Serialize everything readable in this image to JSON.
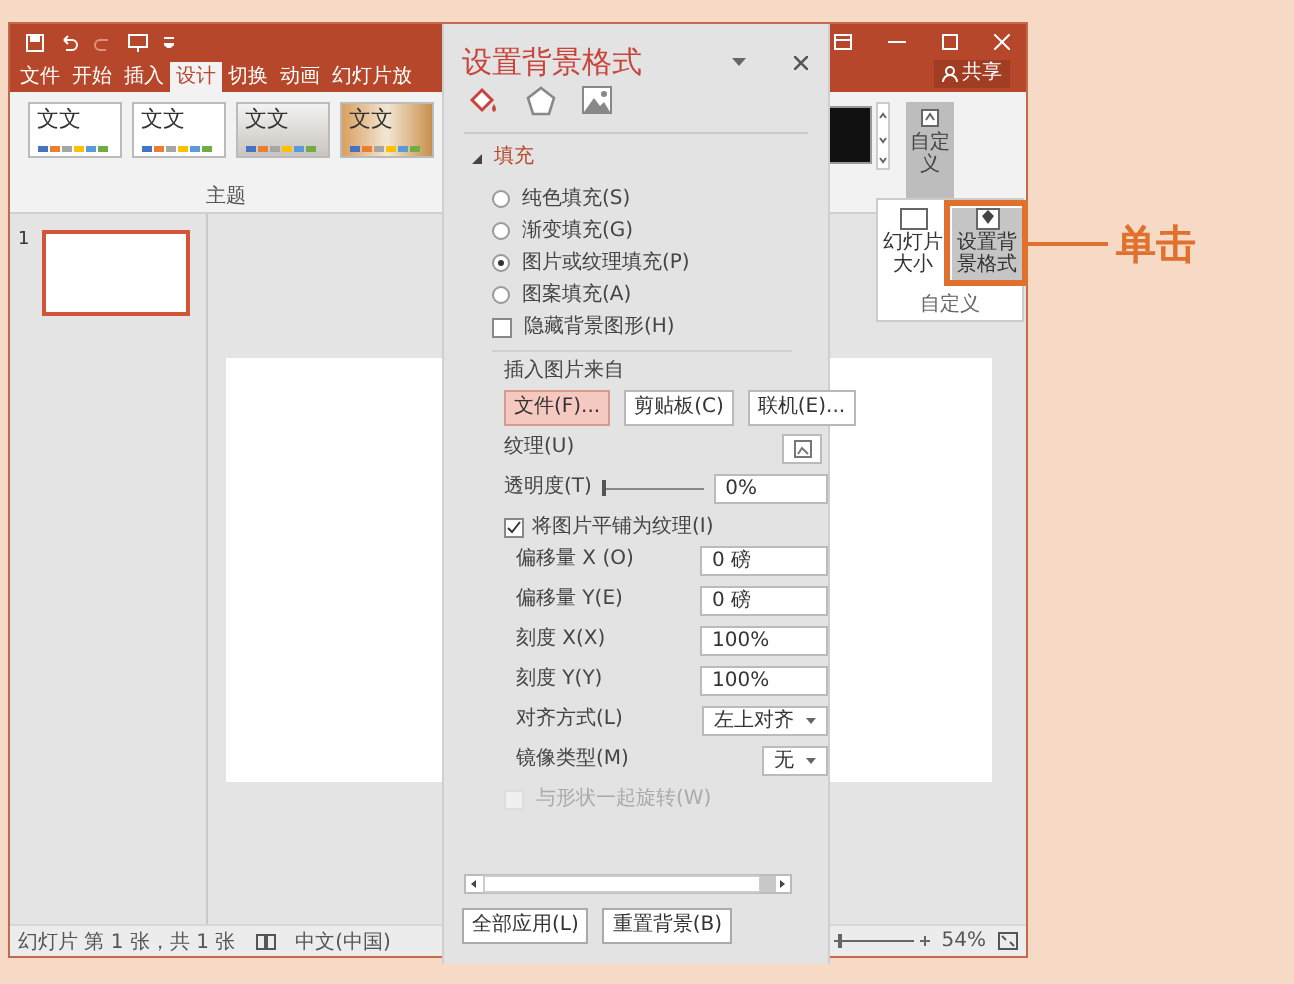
{
  "titlebar": {
    "tabs": [
      {
        "label": "文件",
        "selected": false
      },
      {
        "label": "开始",
        "selected": false
      },
      {
        "label": "插入",
        "selected": false
      },
      {
        "label": "设计",
        "selected": true
      },
      {
        "label": "切换",
        "selected": false
      },
      {
        "label": "动画",
        "selected": false
      },
      {
        "label": "幻灯片放",
        "selected": false
      }
    ],
    "share": "共享"
  },
  "ribbon": {
    "themes": [
      {
        "label": "文文",
        "kind": "plain"
      },
      {
        "label": "文文",
        "kind": "plain"
      },
      {
        "label": "文文",
        "kind": "grey"
      },
      {
        "label": "文文",
        "kind": "photo"
      }
    ],
    "group_label": "主题",
    "custom_button": "自定义",
    "slide_size": "幻灯片大小",
    "format_background": "设置背景格式",
    "custom_group_label": "自定义"
  },
  "slides": [
    {
      "number": "1",
      "selected": true
    }
  ],
  "status_bar": {
    "slide_info": "幻灯片 第 1 张，共 1 张",
    "language": "中文(中国)",
    "zoom_slider": {
      "level": 0.05
    },
    "zoom": "54%"
  },
  "panel": {
    "title": "设置背景格式",
    "tabs": [
      {
        "kind": "fill",
        "selected": true
      },
      {
        "kind": "shape",
        "selected": false
      },
      {
        "kind": "picture",
        "selected": false
      }
    ],
    "section": {
      "label": "填充",
      "expanded": true
    },
    "fill_options": [
      {
        "label": "纯色填充(S)",
        "selected": false
      },
      {
        "label": "渐变填充(G)",
        "selected": false
      },
      {
        "label": "图片或纹理填充(P)",
        "selected": true
      },
      {
        "label": "图案填充(A)",
        "selected": false
      }
    ],
    "hide_graphics": {
      "label": "隐藏背景图形(H)",
      "checked": false
    },
    "insert_label": "插入图片来自",
    "insert_buttons": [
      {
        "label": "文件(F)...",
        "selected": true
      },
      {
        "label": "剪贴板(C)",
        "selected": false
      },
      {
        "label": "联机(E)...",
        "selected": false
      }
    ],
    "texture_label": "纹理(U)",
    "transparency": {
      "label": "透明度(T)",
      "level": 0,
      "value": "0%"
    },
    "tile": {
      "label": "将图片平铺为纹理(I)",
      "checked": true
    },
    "fields": [
      {
        "label": "偏移量 X (O)",
        "value": "0 磅",
        "kind": "spin"
      },
      {
        "label": "偏移量 Y(E)",
        "value": "0 磅",
        "kind": "spin"
      },
      {
        "label": "刻度 X(X)",
        "value": "100%",
        "kind": "spin"
      },
      {
        "label": "刻度 Y(Y)",
        "value": "100%",
        "kind": "spin"
      },
      {
        "label": "对齐方式(L)",
        "value": "左上对齐",
        "kind": "dropdown"
      },
      {
        "label": "镜像类型(M)",
        "value": "无",
        "kind": "dropdown"
      }
    ],
    "rotate": {
      "label": "与形状一起旋转(W)",
      "checked": false,
      "disabled": true
    },
    "buttons": [
      "全部应用(L)",
      "重置背景(B)"
    ]
  },
  "callout": "单击"
}
